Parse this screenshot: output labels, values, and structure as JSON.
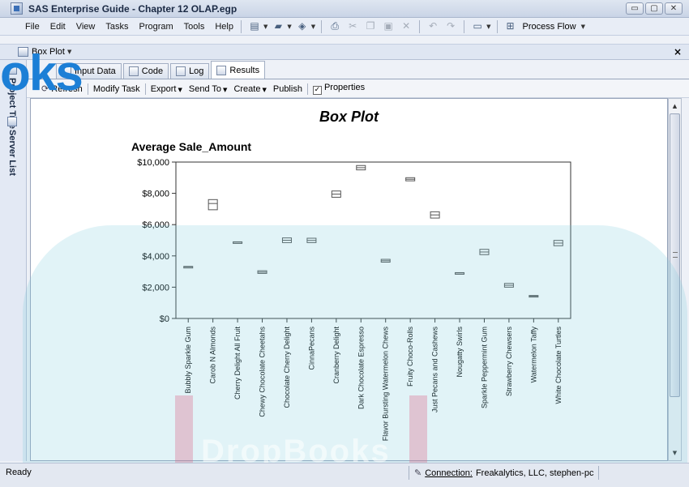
{
  "window": {
    "title": "SAS Enterprise Guide - Chapter 12 OLAP.egp",
    "buttons": [
      "▭",
      "▢",
      "✕"
    ]
  },
  "menubar": {
    "items": [
      "File",
      "Edit",
      "View",
      "Tasks",
      "Program",
      "Tools",
      "Help"
    ],
    "process_flow": "Process Flow"
  },
  "docbar": {
    "label": "Box Plot",
    "close": "×"
  },
  "sidebar": {
    "tabs": [
      "Project Tree",
      "Server List"
    ]
  },
  "tabs": [
    "Input Data",
    "Code",
    "Log",
    "Results"
  ],
  "actions": [
    "Refresh",
    "Modify Task",
    "Export",
    "Send To",
    "Create",
    "Publish",
    "Properties"
  ],
  "watermark": {
    "text": "oks",
    "bottom_text": "DropBooks"
  },
  "chart": {
    "title": "Box Plot",
    "y_title": "Average Sale_Amount"
  },
  "chart_data": {
    "type": "box",
    "title": "Box Plot",
    "ylabel": "Average Sale_Amount",
    "ylim": [
      0,
      10000
    ],
    "yticks": [
      "$0",
      "$2,000",
      "$4,000",
      "$6,000",
      "$8,000",
      "$10,000"
    ],
    "ytick_values": [
      0,
      2000,
      4000,
      6000,
      8000,
      10000
    ],
    "grid": false,
    "categories": [
      "Bubbly Sparkle Gum",
      "Carob N Almonds",
      "Cherry Delight All Fruit",
      "Chewy Chocolate Cheetahs",
      "Chocolate Cherry Delight",
      "CinnaPecans",
      "Cranberry Delight",
      "Dark Chocolate Espresso",
      "Flavor Bursting Watermelon Chews",
      "Fruity Choco-Rolls",
      "Just Pecans and Cashews",
      "Nougatty Swirls",
      "Sparkle Peppermint Gum",
      "Strawberry Chewsers",
      "Watermelon Taffy",
      "White Chocolate Turtles"
    ],
    "low": [
      3270,
      6950,
      4850,
      2880,
      4850,
      4850,
      7750,
      9500,
      3600,
      8800,
      6420,
      2900,
      4080,
      2000,
      1380,
      4650
    ],
    "high": [
      3330,
      7600,
      4900,
      3050,
      5150,
      5130,
      8150,
      9780,
      3780,
      9000,
      6820,
      2930,
      4420,
      2240,
      1470,
      4990
    ],
    "median": [
      3300,
      7350,
      4880,
      2960,
      5000,
      4990,
      7950,
      9640,
      3690,
      8900,
      6620,
      2910,
      4250,
      2120,
      1420,
      4820
    ]
  },
  "statusbar": {
    "ready": "Ready",
    "connection_label": "Connection:",
    "connection_value": "Freakalytics, LLC, stephen-pc"
  }
}
